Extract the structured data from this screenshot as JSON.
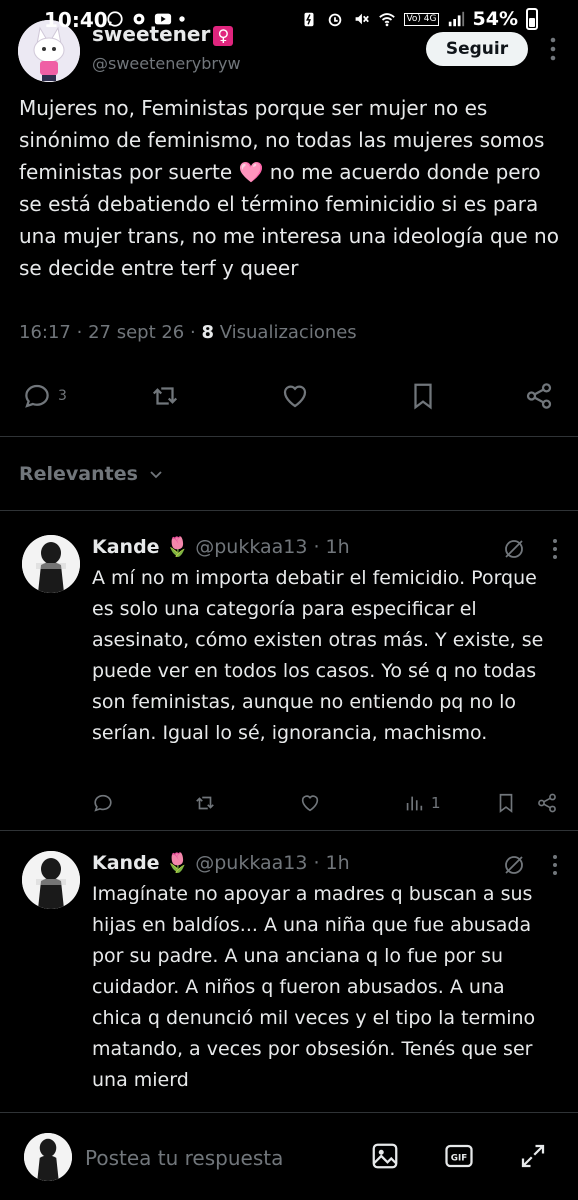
{
  "status_bar": {
    "time": "10:40",
    "battery_pct": "54%",
    "network": "Vo) 4G"
  },
  "tweet": {
    "author_name": "sweetener",
    "author_emoji": "♀",
    "author_handle": "@sweetenerybryw",
    "follow_label": "Seguir",
    "text": "Mujeres no, Feministas porque ser mujer no es sinónimo de feminismo, no todas las mujeres somos feministas por suerte 🩷 no me acuerdo donde pero se está debatiendo el término feminicidio si es para una mujer trans, no me interesa una ideología que no se decide entre terf y queer",
    "time": "16:17",
    "date": "27 sept 26",
    "views_count": "8",
    "views_label": "Visualizaciones",
    "reply_count": "3"
  },
  "sort": {
    "label": "Relevantes"
  },
  "replies": [
    {
      "name": "Kande",
      "emoji": "🌷",
      "handle": "@pukkaa13",
      "time": "1h",
      "text": "A mí no m importa debatir el femicidio. Porque es solo una categoría para especificar el asesinato, cómo existen otras más. Y existe, se puede ver en todos los casos. Yo sé q no todas son feministas, aunque no entiendo pq no lo serían. Igual lo sé, ignorancia, machismo.",
      "views": "1"
    },
    {
      "name": "Kande",
      "emoji": "🌷",
      "handle": "@pukkaa13",
      "time": "1h",
      "text": "Imagínate no apoyar a madres q buscan a sus hijas en baldíos... A una niña que fue abusada por su padre. A una anciana q lo fue por su cuidador. A niños q fueron abusados. A una chica q denunció mil veces y el tipo la termino matando, a veces por obsesión. Tenés que ser una mierd"
    }
  ],
  "compose": {
    "placeholder": "Postea tu respuesta",
    "gif_label": "GIF"
  },
  "colors": {
    "background": "#000000",
    "text": "#e7e9ea",
    "muted": "#71767b",
    "divider": "#2f3336"
  }
}
